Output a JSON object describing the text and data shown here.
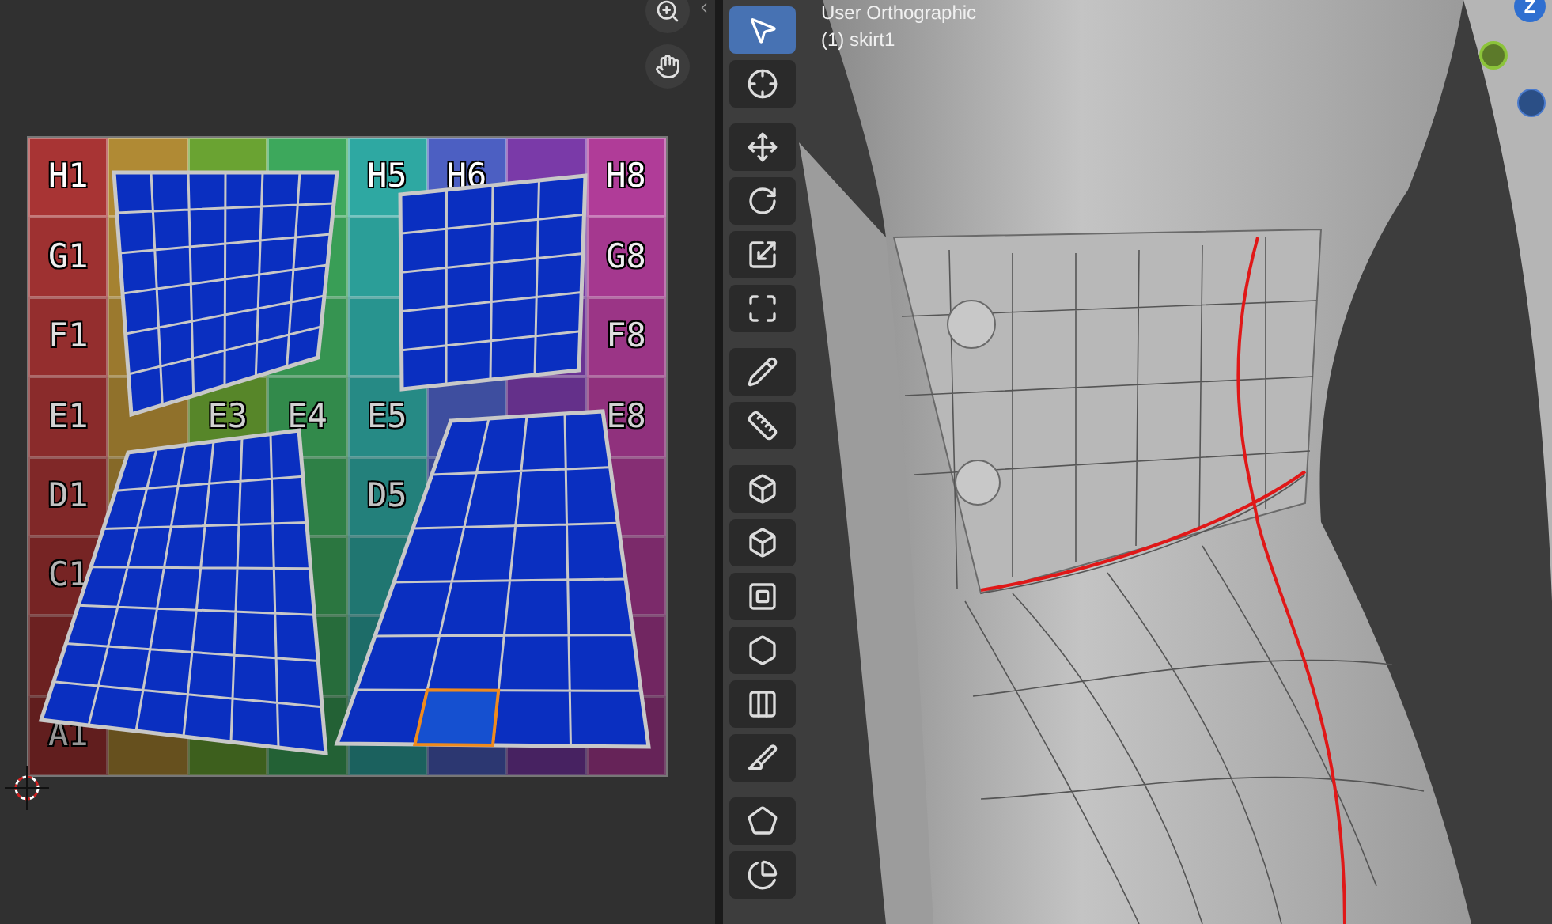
{
  "uv_editor": {
    "grid_rows": [
      [
        "H1",
        null,
        null,
        null,
        "H5",
        "H6",
        null,
        "H8"
      ],
      [
        "G1",
        null,
        null,
        null,
        null,
        null,
        null,
        "G8"
      ],
      [
        "F1",
        null,
        null,
        null,
        null,
        null,
        null,
        "F8"
      ],
      [
        "E1",
        null,
        "E3",
        "E4",
        "E5",
        null,
        null,
        "E8"
      ],
      [
        "D1",
        null,
        null,
        null,
        "D5",
        null,
        null,
        null
      ],
      [
        "C1",
        null,
        null,
        null,
        null,
        null,
        null,
        null
      ],
      [
        null,
        null,
        null,
        null,
        null,
        null,
        null,
        null
      ],
      [
        "A1",
        null,
        null,
        null,
        null,
        null,
        null,
        null
      ]
    ]
  },
  "viewport": {
    "view_name": "User Orthographic",
    "object_label": "(1) skirt1",
    "axis_label": "Z"
  },
  "toolbar": [
    {
      "kind": "select",
      "selected": true
    },
    {
      "kind": "cursor",
      "selected": false
    },
    {
      "kind": "move",
      "selected": false
    },
    {
      "kind": "rotate",
      "selected": false
    },
    {
      "kind": "scale",
      "selected": false
    },
    {
      "kind": "transform",
      "selected": false
    },
    {
      "kind": "annotate",
      "selected": false
    },
    {
      "kind": "measure",
      "selected": false
    },
    {
      "kind": "add-cube",
      "selected": false
    },
    {
      "kind": "extrude",
      "selected": false
    },
    {
      "kind": "inset",
      "selected": false
    },
    {
      "kind": "bevel",
      "selected": false
    },
    {
      "kind": "loop-cut",
      "selected": false
    },
    {
      "kind": "knife",
      "selected": false
    },
    {
      "kind": "poly-build",
      "selected": false
    },
    {
      "kind": "spin",
      "selected": false
    }
  ]
}
